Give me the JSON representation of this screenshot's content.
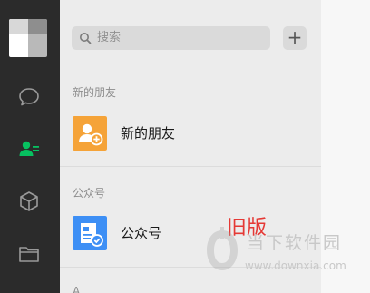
{
  "search": {
    "placeholder": "搜索",
    "add_label": "+"
  },
  "sidebar": {
    "items": [
      {
        "name": "chat",
        "icon": "chat-bubble-icon",
        "active": false
      },
      {
        "name": "contacts",
        "icon": "contacts-icon",
        "active": true
      },
      {
        "name": "mini-programs",
        "icon": "cube-icon",
        "active": false
      },
      {
        "name": "files",
        "icon": "folder-icon",
        "active": false
      }
    ]
  },
  "sections": [
    {
      "label": "新的朋友",
      "item": {
        "name": "新的朋友",
        "icon": "new-friend-icon",
        "color": "#f5a338"
      }
    },
    {
      "label": "公众号",
      "item": {
        "name": "公众号",
        "icon": "official-account-icon",
        "color": "#3d8ff5"
      }
    },
    {
      "label": "A"
    }
  ],
  "annotation": {
    "text": "旧版",
    "color": "#e53935"
  },
  "watermark": {
    "name": "当下软件园",
    "url": "www.downxia.com"
  },
  "colors": {
    "sidebar": "#2b2b2b",
    "active": "#07c160",
    "panel": "#ececec"
  }
}
